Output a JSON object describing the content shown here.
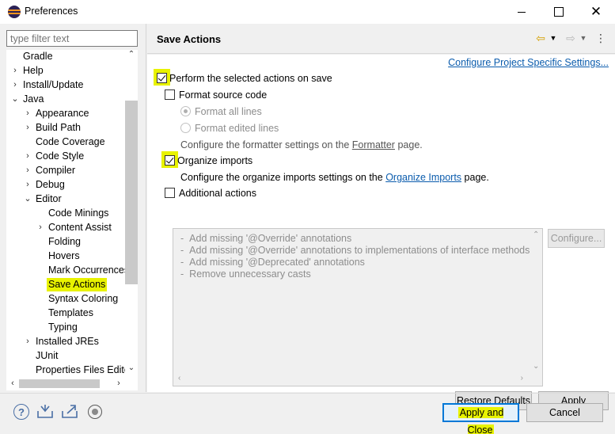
{
  "window": {
    "title": "Preferences",
    "minimize": "",
    "maximize": "",
    "close": "✕"
  },
  "filter": {
    "placeholder": "type filter text"
  },
  "tree": {
    "items": [
      {
        "label": "Gradle",
        "twisty": "",
        "level": 1
      },
      {
        "label": "Help",
        "twisty": "›",
        "level": 1
      },
      {
        "label": "Install/Update",
        "twisty": "›",
        "level": 1
      },
      {
        "label": "Java",
        "twisty": "⌄",
        "level": 1
      },
      {
        "label": "Appearance",
        "twisty": "›",
        "level": 2
      },
      {
        "label": "Build Path",
        "twisty": "›",
        "level": 2
      },
      {
        "label": "Code Coverage",
        "twisty": "",
        "level": 2
      },
      {
        "label": "Code Style",
        "twisty": "›",
        "level": 2
      },
      {
        "label": "Compiler",
        "twisty": "›",
        "level": 2
      },
      {
        "label": "Debug",
        "twisty": "›",
        "level": 2
      },
      {
        "label": "Editor",
        "twisty": "⌄",
        "level": 2
      },
      {
        "label": "Code Minings",
        "twisty": "",
        "level": 3
      },
      {
        "label": "Content Assist",
        "twisty": "›",
        "level": 3
      },
      {
        "label": "Folding",
        "twisty": "",
        "level": 3
      },
      {
        "label": "Hovers",
        "twisty": "",
        "level": 3
      },
      {
        "label": "Mark Occurrences",
        "twisty": "",
        "level": 3
      },
      {
        "label": "Save Actions",
        "twisty": "",
        "level": 3,
        "selected": true
      },
      {
        "label": "Syntax Coloring",
        "twisty": "",
        "level": 3
      },
      {
        "label": "Templates",
        "twisty": "",
        "level": 3
      },
      {
        "label": "Typing",
        "twisty": "",
        "level": 3
      },
      {
        "label": "Installed JREs",
        "twisty": "›",
        "level": 2
      },
      {
        "label": "JUnit",
        "twisty": "",
        "level": 2
      },
      {
        "label": "Properties Files Edito",
        "twisty": "",
        "level": 2
      }
    ],
    "scroll_up": "⌃",
    "scroll_down": "⌄",
    "scroll_left": "‹",
    "scroll_right": "›"
  },
  "header": {
    "title": "Save Actions",
    "back_icon": "⇦",
    "fwd_icon": "⇨",
    "drop_icon": "▼",
    "menu_icon": "⋮"
  },
  "page": {
    "config_link": "Configure Project Specific Settings...",
    "perform_label": "Perform the selected actions on save",
    "perform_checked": true,
    "format_label": "Format source code",
    "format_checked": false,
    "format_all": "Format all lines",
    "format_edited": "Format edited lines",
    "format_info_prefix": "Configure the formatter settings on the ",
    "format_info_link": "Formatter",
    "format_info_suffix": " page.",
    "organize_label": "Organize imports",
    "organize_checked": true,
    "organize_info_prefix": "Configure the organize imports settings on the ",
    "organize_info_link": "Organize Imports",
    "organize_info_suffix": " page.",
    "additional_label": "Additional actions",
    "additional_checked": false,
    "additional_actions": [
      "Add missing '@Override' annotations",
      "Add missing '@Override' annotations to implementations of interface methods",
      "Add missing '@Deprecated' annotations",
      "Remove unnecessary casts"
    ],
    "configure_button": "Configure...",
    "restore_button": "Restore Defaults",
    "apply_button": "Apply",
    "bullet": "-"
  },
  "footer": {
    "apply_close_button": "Apply and Close",
    "cancel_button": "Cancel",
    "help_icon": "?"
  },
  "colors": {
    "highlight": "#e8f200",
    "link": "#0b5cad",
    "primary_border": "#0078d7"
  }
}
